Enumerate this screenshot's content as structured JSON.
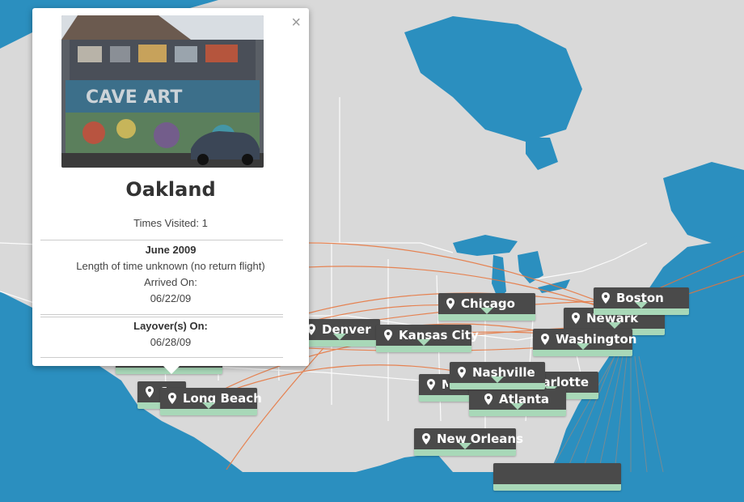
{
  "map": {
    "colors": {
      "water": "#2b8fbf",
      "land": "#d9d9d9",
      "border": "#ffffff",
      "route": "#e8743b"
    },
    "cities": [
      {
        "name": "Chicago"
      },
      {
        "name": "Boston"
      },
      {
        "name": "Newark"
      },
      {
        "name": "Washington"
      },
      {
        "name": "Denver"
      },
      {
        "name": "Kansas City"
      },
      {
        "name": "Nashville"
      },
      {
        "name": "Charlotte"
      },
      {
        "name": "Atlanta"
      },
      {
        "name": "New Orleans"
      },
      {
        "name": "San Diego"
      },
      {
        "name": "Long Beach"
      },
      {
        "name": "Memphis"
      }
    ],
    "marker_colors": {
      "box": "#4a4a4a",
      "accent": "#a8d8b8"
    }
  },
  "popup": {
    "close_label": "×",
    "photo_icon": "graffiti-photo",
    "city": "Oakland",
    "times_visited": "Times Visited: 1",
    "trip_date": "June 2009",
    "trip_length": "Length of time unknown (no return flight)",
    "arrived_label": "Arrived On:",
    "arrived_date": "06/22/09",
    "layover_label": "Layover(s) On:",
    "layover_date": "06/28/09"
  }
}
